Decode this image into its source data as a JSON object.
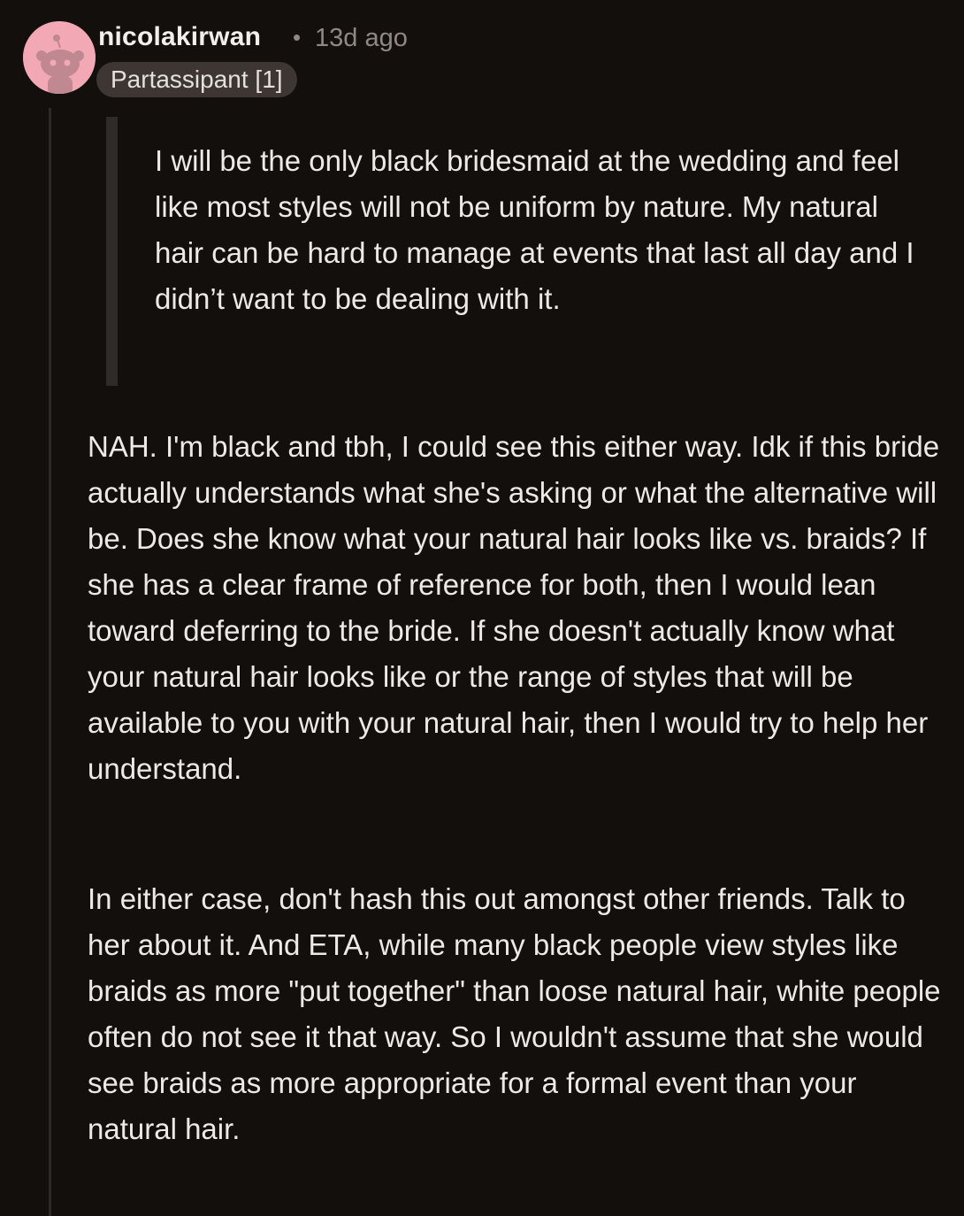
{
  "comment": {
    "username": "nicolakirwan",
    "separator": "•",
    "timestamp": "13d ago",
    "flair": "Partassipant [1]",
    "avatar_icon": "reddit-snoo-avatar-icon",
    "quote": "I will be the only black bridesmaid at the wedding and feel like most styles will not be uniform by nature. My natural hair can be hard to manage at events that last all day and I didn’t want to be dealing with it.",
    "paragraphs": [
      "NAH. I'm black and tbh, I could see this either way. Idk if this bride actually understands what she's asking or what the alternative will be. Does she know what your natural hair looks like vs. braids? If she has a clear frame of reference for both, then I would lean toward deferring to the bride. If she doesn't actually know what your natural hair looks like or the range of styles that will be available to you with your natural hair, then I would try to help her understand.",
      "In either case, don't hash this out amongst other friends. Talk to her about it. And ETA, while many black people view styles like braids as more \"put together\" than loose natural hair, white people often do not see it that way. So I wouldn't assume that she would see braids as more appropriate for a formal event than your natural hair."
    ]
  },
  "colors": {
    "background": "#130f0d",
    "avatar_background": "#f2a9b5",
    "flair_background": "#3d3632",
    "muted_text": "#8f8984",
    "body_text": "#ece9e6"
  }
}
